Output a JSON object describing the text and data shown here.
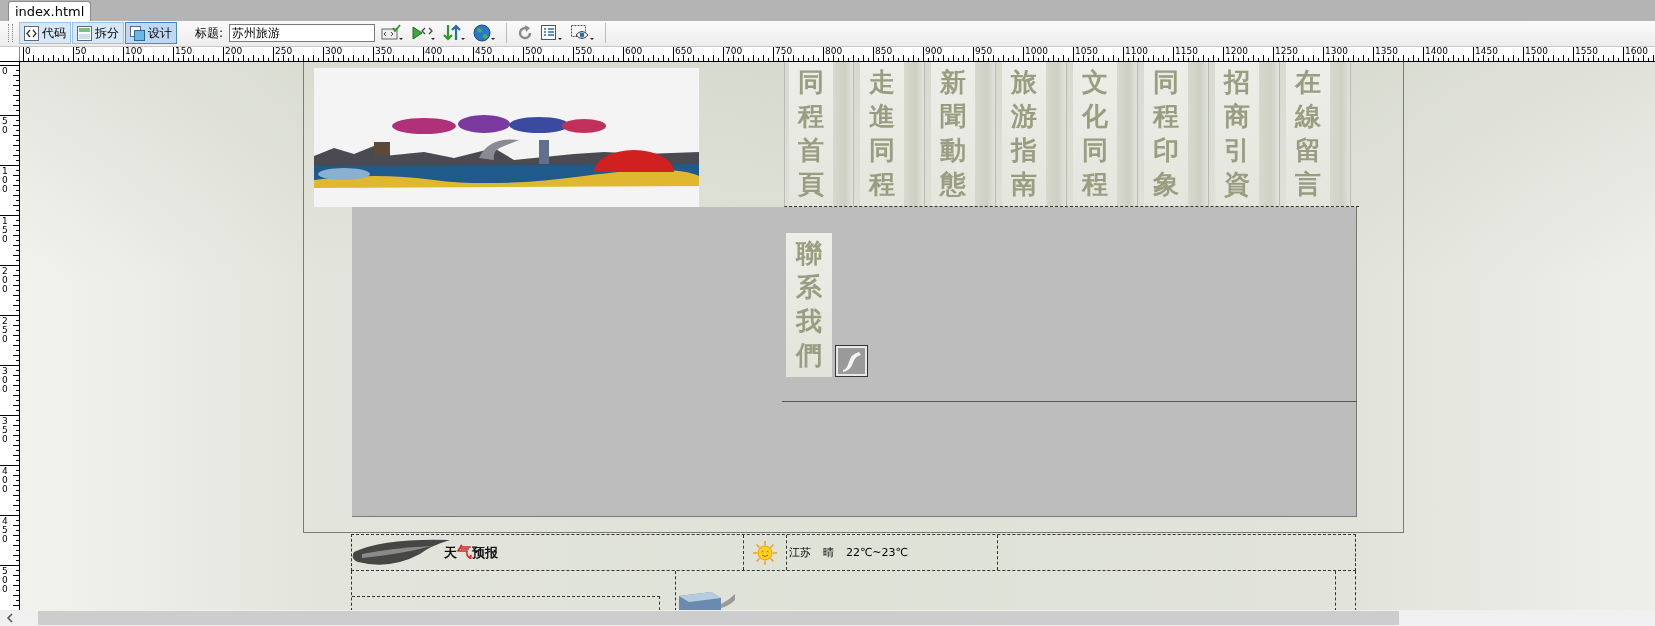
{
  "document_tab": {
    "label": "index.html",
    "selected": true
  },
  "toolbar": {
    "view_buttons": [
      {
        "label": "代码",
        "selected": false
      },
      {
        "label": "拆分",
        "selected": false
      },
      {
        "label": "设计",
        "selected": true
      }
    ],
    "title_label": "标题:",
    "title_field": {
      "value": "苏州旅游"
    }
  },
  "horizontal_ruler": {
    "labels": [
      "0",
      "50",
      "100",
      "150",
      "200",
      "250",
      "300",
      "350",
      "400",
      "450",
      "500",
      "550",
      "600",
      "650",
      "700",
      "750",
      "800",
      "850",
      "900",
      "950",
      "1000",
      "1050",
      "1100",
      "1150",
      "1200",
      "1250",
      "1300",
      "1350",
      "1400",
      "1450",
      "1500",
      "1550",
      "1600"
    ]
  },
  "vertical_ruler": {
    "labels": [
      "0",
      "50",
      "100",
      "150",
      "200",
      "250",
      "300",
      "350",
      "400",
      "450",
      "500"
    ]
  },
  "page": {
    "nav": [
      {
        "label": "同程首頁"
      },
      {
        "label": "走進同程"
      },
      {
        "label": "新聞動態"
      },
      {
        "label": "旅游指南"
      },
      {
        "label": "文化同程"
      },
      {
        "label": "同程印象"
      },
      {
        "label": "招商引資"
      },
      {
        "label": "在線留言"
      }
    ],
    "contact_link": {
      "label": "聯系我們"
    },
    "weather": {
      "title": [
        {
          "text": "天",
          "accent": false
        },
        {
          "text": "气",
          "accent": true
        },
        {
          "text": "预报",
          "accent": false
        }
      ],
      "region": "江苏",
      "condition": "晴",
      "temperature": "22℃~23℃"
    }
  }
}
